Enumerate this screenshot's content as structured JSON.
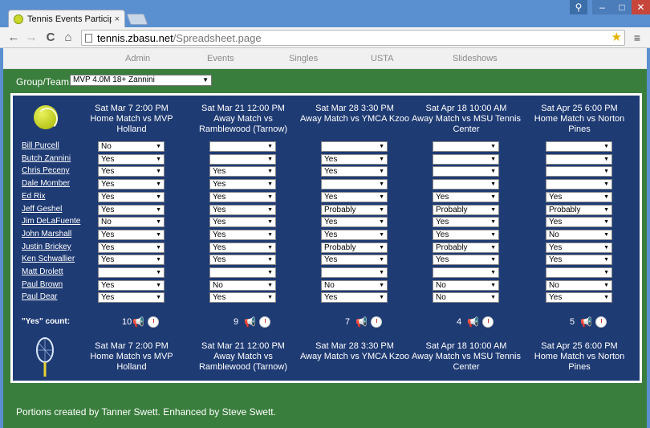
{
  "browser": {
    "tab_title": "Tennis Events Participation",
    "tab_close": "×",
    "url_host": "tennis.zbasu.net",
    "url_path": "/Spreadsheet.page",
    "back": "←",
    "forward": "→",
    "reload": "C",
    "home": "⌂",
    "menu": "≡",
    "star": "★",
    "win_user": "⚲",
    "win_min": "–",
    "win_max": "□",
    "win_close": "✕"
  },
  "nav": {
    "items": [
      "Admin",
      "Events",
      "Singles",
      "USTA",
      "Slideshows"
    ]
  },
  "group": {
    "label": "Group/Team:",
    "value": "MVP 4.0M 18+ Zannini",
    "arrow": "▼"
  },
  "events": [
    {
      "date": "Sat Mar 7 2:00 PM",
      "desc": "Home Match vs MVP Holland"
    },
    {
      "date": "Sat Mar 21 12:00 PM",
      "desc": "Away Match vs Ramblewood (Tarnow)"
    },
    {
      "date": "Sat Mar 28 3:30 PM",
      "desc": "Away Match vs YMCA Kzoo"
    },
    {
      "date": "Sat Apr 18 10:00 AM",
      "desc": "Away Match vs MSU Tennis Center"
    },
    {
      "date": "Sat Apr 25 6:00 PM",
      "desc": "Home Match vs Norton Pines"
    }
  ],
  "players": [
    {
      "name": "Bill Purcell",
      "responses": [
        "No",
        "",
        "",
        "",
        ""
      ]
    },
    {
      "name": "Butch Zannini",
      "responses": [
        "Yes",
        "",
        "Yes",
        "",
        ""
      ]
    },
    {
      "name": "Chris Peceny",
      "responses": [
        "Yes",
        "Yes",
        "Yes",
        "",
        ""
      ]
    },
    {
      "name": "Dale Momber",
      "responses": [
        "Yes",
        "Yes",
        "",
        "",
        ""
      ]
    },
    {
      "name": "Ed Rix",
      "responses": [
        "Yes",
        "Yes",
        "Yes",
        "Yes",
        "Yes"
      ]
    },
    {
      "name": "Jeff Geshel",
      "responses": [
        "Yes",
        "Yes",
        "Probably",
        "Probably",
        "Probably"
      ]
    },
    {
      "name": "Jim DeLaFuente",
      "responses": [
        "No",
        "Yes",
        "Yes",
        "Yes",
        "Yes"
      ]
    },
    {
      "name": "John Marshall",
      "responses": [
        "Yes",
        "Yes",
        "Yes",
        "Yes",
        "No"
      ]
    },
    {
      "name": "Justin Brickey",
      "responses": [
        "Yes",
        "Yes",
        "Probably",
        "Probably",
        "Yes"
      ]
    },
    {
      "name": "Ken Schwallier",
      "responses": [
        "Yes",
        "Yes",
        "Yes",
        "Yes",
        "Yes"
      ]
    },
    {
      "name": "Matt Drolett",
      "responses": [
        "",
        "",
        "",
        "",
        ""
      ]
    },
    {
      "name": "Paul Brown",
      "responses": [
        "Yes",
        "No",
        "No",
        "No",
        "No"
      ]
    },
    {
      "name": "Paul Dear",
      "responses": [
        "Yes",
        "Yes",
        "Yes",
        "No",
        "Yes"
      ]
    }
  ],
  "count_label": "\"Yes\" count:",
  "counts": [
    "10",
    "9",
    "7",
    "4",
    "5"
  ],
  "megaphone_glyph": "📢",
  "select_arrow": "▼",
  "footer": "Portions created by Tanner Swett. Enhanced by Steve Swett.",
  "colors": {
    "panel": "#1f3b74",
    "page_bg": "#3a7e3d",
    "chrome": "#5a8fd0"
  }
}
